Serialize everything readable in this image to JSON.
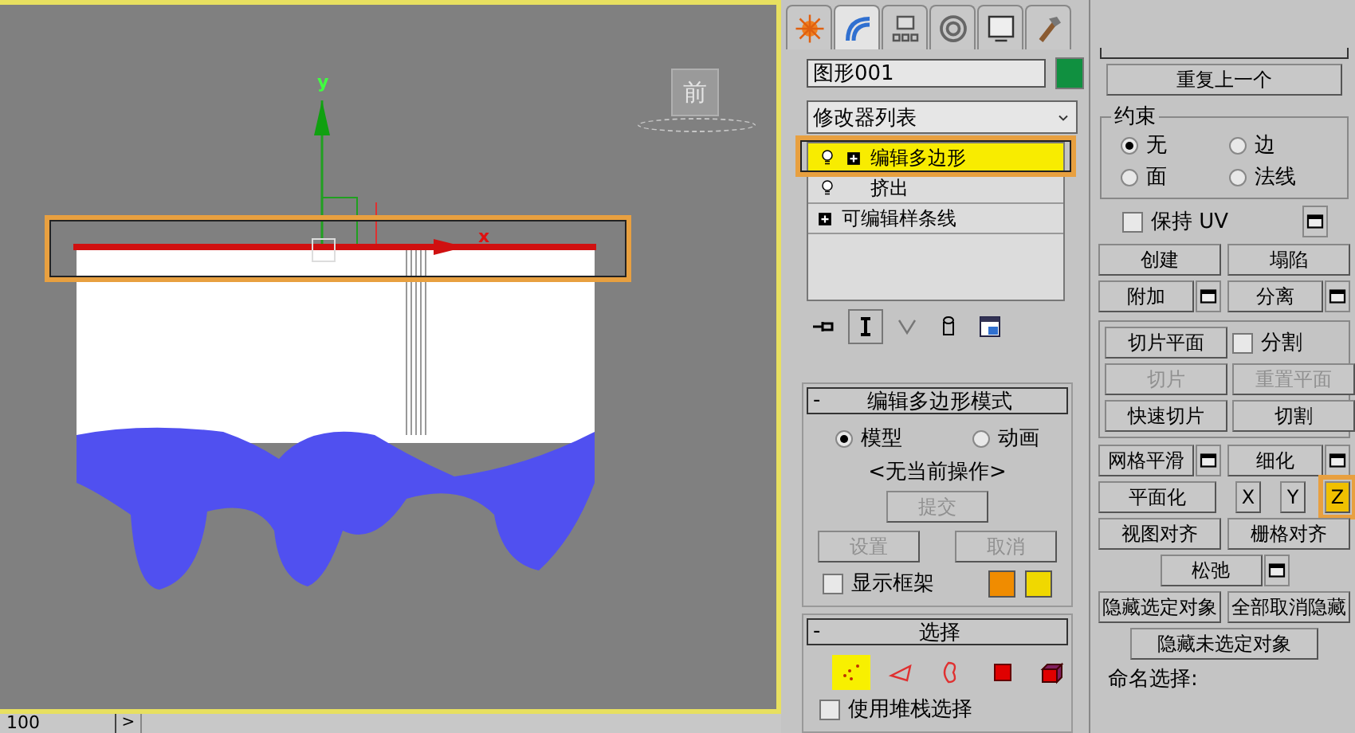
{
  "viewport": {
    "view_cube": "前",
    "axis_y": "y",
    "axis_x": "x",
    "gizmo_highlighted": true,
    "time_slider": {
      "frame": "100",
      "next": ">"
    }
  },
  "command_panel": {
    "tabs": [
      {
        "kind": "create",
        "selected": false
      },
      {
        "kind": "modify",
        "selected": true
      },
      {
        "kind": "hierarchy",
        "selected": false
      },
      {
        "kind": "motion",
        "selected": false
      },
      {
        "kind": "display",
        "selected": false
      },
      {
        "kind": "utilities",
        "selected": false
      }
    ],
    "object": {
      "name": "图形001",
      "color": "#109040"
    },
    "modifier_list": "修改器列表",
    "stack": [
      {
        "label": "编辑多边形",
        "light": true,
        "expandable": true,
        "selected": true,
        "highlighted": true
      },
      {
        "label": "挤出",
        "light": true,
        "expandable": false,
        "selected": false,
        "highlighted": false
      },
      {
        "label": "可编辑样条线",
        "light": false,
        "expandable": true,
        "selected": false,
        "highlighted": false
      }
    ],
    "stack_tools": [
      {
        "kind": "pin",
        "selected": false
      },
      {
        "kind": "show_end",
        "selected": true
      },
      {
        "kind": "unique",
        "selected": false
      },
      {
        "kind": "remove",
        "selected": false
      },
      {
        "kind": "configure",
        "selected": false
      }
    ],
    "edit_poly_mode": {
      "title": "编辑多边形模式",
      "collapse": "-",
      "modes": [
        {
          "label": "模型",
          "selected": true
        },
        {
          "label": "动画",
          "selected": false
        }
      ],
      "status": "<无当前操作>",
      "commit": {
        "label": "提交",
        "disabled": true
      },
      "buttons": [
        {
          "label": "设置",
          "disabled": true
        },
        {
          "label": "取消",
          "disabled": true
        }
      ],
      "show_cage": {
        "label": "显示框架",
        "checked": false
      },
      "cage_colors": [
        {
          "color": "#f08c00"
        },
        {
          "color": "#f0d800"
        }
      ]
    },
    "selection": {
      "title": "选择",
      "collapse": "-",
      "levels": [
        {
          "kind": "vertex",
          "selected": true
        },
        {
          "kind": "edge",
          "selected": false
        },
        {
          "kind": "border",
          "selected": false
        },
        {
          "kind": "polygon",
          "selected": false
        },
        {
          "kind": "element",
          "selected": false
        }
      ],
      "use_stack": {
        "label": "使用堆栈选择",
        "checked": false
      }
    },
    "edit_geometry": {
      "repeat_last": "重复上一个",
      "constraints": {
        "title": "约束",
        "options": [
          {
            "label": "无",
            "selected": true
          },
          {
            "label": "边",
            "selected": false
          },
          {
            "label": "面",
            "selected": false
          },
          {
            "label": "法线",
            "selected": false
          }
        ]
      },
      "preserve_uv": {
        "label": "保持 UV",
        "checked": false
      },
      "sections": [
        {
          "framed": false,
          "rows": [
            [
              {
                "kind": "button",
                "label": "创建",
                "settings": false,
                "disabled": false
              },
              {
                "kind": "button",
                "label": "塌陷",
                "settings": false,
                "disabled": false
              }
            ],
            [
              {
                "kind": "button",
                "label": "附加",
                "settings": true,
                "disabled": false
              },
              {
                "kind": "button",
                "label": "分离",
                "settings": true,
                "disabled": false
              }
            ]
          ]
        },
        {
          "framed": true,
          "rows": [
            [
              {
                "kind": "button",
                "label": "切片平面",
                "settings": false,
                "disabled": false
              },
              {
                "kind": "checkbox",
                "label": "分割",
                "checked": false
              }
            ],
            [
              {
                "kind": "button",
                "label": "切片",
                "settings": false,
                "disabled": true
              },
              {
                "kind": "button",
                "label": "重置平面",
                "settings": false,
                "disabled": true
              }
            ],
            [
              {
                "kind": "button",
                "label": "快速切片",
                "settings": false,
                "disabled": false
              },
              {
                "kind": "button",
                "label": "切割",
                "settings": false,
                "disabled": false
              }
            ]
          ]
        },
        {
          "framed": false,
          "rows": [
            [
              {
                "kind": "button",
                "label": "网格平滑",
                "settings": true,
                "disabled": false
              },
              {
                "kind": "button",
                "label": "细化",
                "settings": true,
                "disabled": false
              }
            ],
            [
              {
                "kind": "button",
                "label": "平面化",
                "settings": false,
                "disabled": false
              },
              {
                "kind": "axis",
                "label": "X",
                "highlighted": false
              },
              {
                "kind": "axis",
                "label": "Y",
                "highlighted": false
              },
              {
                "kind": "axis",
                "label": "Z",
                "highlighted": true
              }
            ],
            [
              {
                "kind": "button",
                "label": "视图对齐",
                "settings": false,
                "disabled": false
              },
              {
                "kind": "button",
                "label": "栅格对齐",
                "settings": false,
                "disabled": false
              }
            ],
            [
              {
                "kind": "button",
                "label": "松弛",
                "settings": true,
                "disabled": false
              }
            ],
            [
              {
                "kind": "button",
                "label": "隐藏选定对象",
                "settings": false,
                "disabled": false
              },
              {
                "kind": "button",
                "label": "全部取消隐藏",
                "settings": false,
                "disabled": false
              }
            ],
            [
              {
                "kind": "button",
                "label": "隐藏未选定对象",
                "settings": false,
                "disabled": false
              }
            ]
          ]
        }
      ],
      "named_selections": "命名选择:"
    }
  }
}
